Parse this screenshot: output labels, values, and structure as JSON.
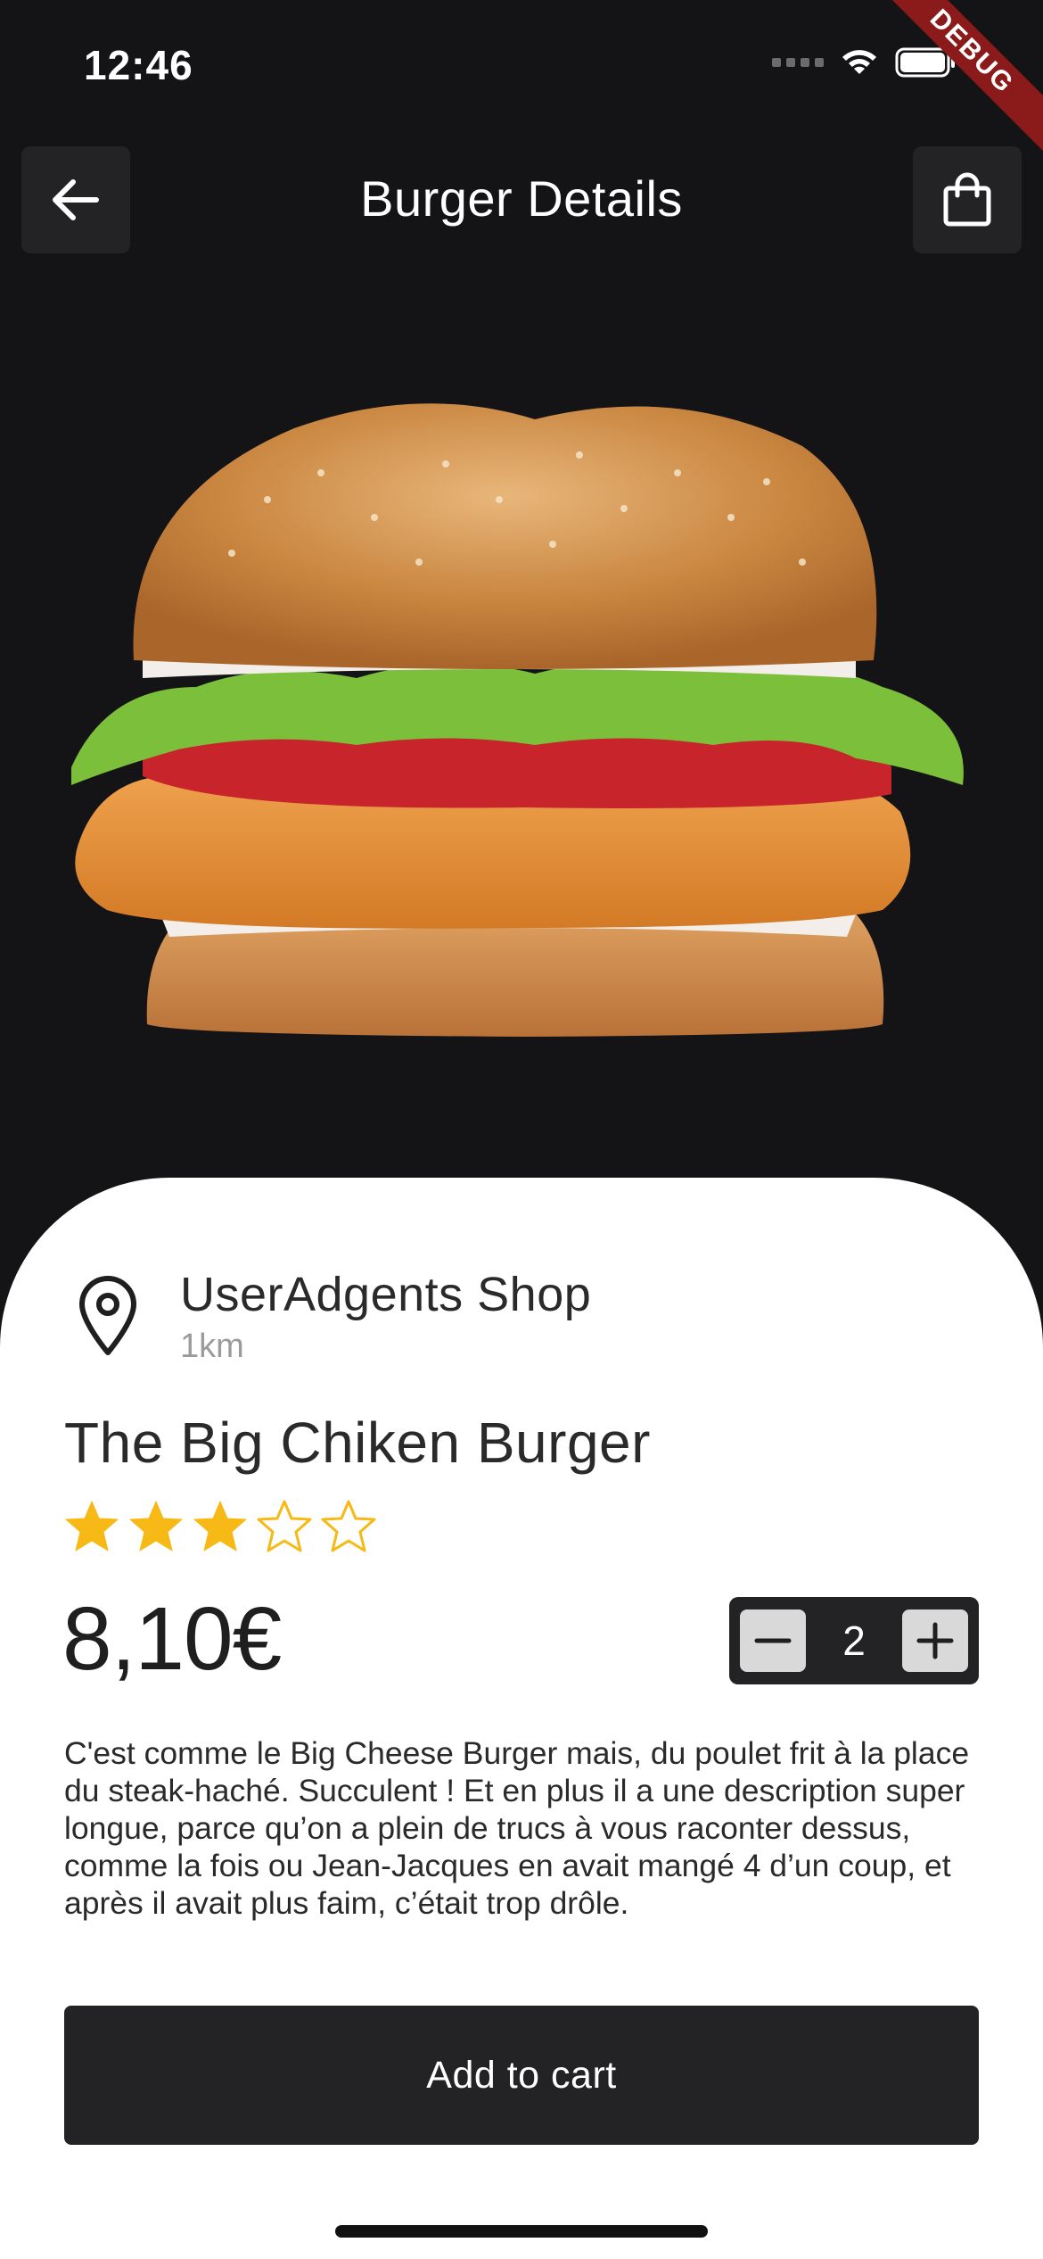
{
  "status_bar": {
    "time": "12:46",
    "debug_label": "DEBUG"
  },
  "header": {
    "title": "Burger Details",
    "back_icon": "arrow-left-icon",
    "cart_icon": "shopping-bag-icon"
  },
  "hero": {
    "image": "chicken-burger-photo"
  },
  "shop": {
    "name": "UserAdgents Shop",
    "distance": "1km",
    "icon": "location-pin-icon"
  },
  "product": {
    "name": "The Big Chiken Burger",
    "rating": 3,
    "rating_max": 5,
    "price": "8,10€",
    "quantity": "2",
    "description": "C'est comme le Big Cheese Burger mais, du poulet frit à la place du steak-haché. Succulent ! Et en plus il a une description super longue, parce qu’on a plein de trucs à vous raconter dessus, comme la fois ou Jean-Jacques en avait mangé 4 d’un coup, et après il avait plus faim, c’était trop drôle."
  },
  "actions": {
    "add_to_cart": "Add to cart"
  },
  "colors": {
    "background": "#141316",
    "sheet": "#ffffff",
    "star": "#f7b916",
    "button": "#232325"
  }
}
